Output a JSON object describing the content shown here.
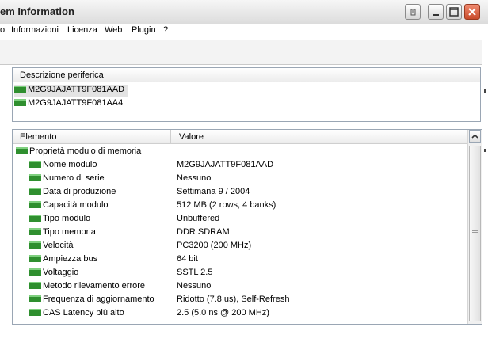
{
  "window": {
    "title": "em Information"
  },
  "menu": {
    "items": [
      {
        "label": "o"
      },
      {
        "label": "Informazioni"
      },
      {
        "label": "Licenza"
      },
      {
        "label": "Web"
      },
      {
        "label": "Plugin"
      },
      {
        "label": "?"
      }
    ]
  },
  "devices": {
    "header": "Descrizione periferica",
    "items": [
      {
        "label": "M2G9JAJATT9F081AAD",
        "selected": true,
        "icon": "memory-module-icon"
      },
      {
        "label": "M2G9JAJATT9F081AA4",
        "selected": false,
        "icon": "memory-module-icon"
      }
    ]
  },
  "properties": {
    "headers": {
      "element": "Elemento",
      "value": "Valore"
    },
    "group": {
      "label": "Proprietà modulo di memoria",
      "icon": "memory-module-icon"
    },
    "rows": [
      {
        "name": "Nome modulo",
        "value": "M2G9JAJATT9F081AAD"
      },
      {
        "name": "Numero di serie",
        "value": "Nessuno"
      },
      {
        "name": "Data di produzione",
        "value": "Settimana 9 / 2004"
      },
      {
        "name": "Capacità modulo",
        "value": "512 MB (2 rows, 4 banks)"
      },
      {
        "name": "Tipo modulo",
        "value": "Unbuffered"
      },
      {
        "name": "Tipo memoria",
        "value": "DDR SDRAM"
      },
      {
        "name": "Velocità",
        "value": "PC3200 (200 MHz)"
      },
      {
        "name": "Ampiezza bus",
        "value": "64 bit"
      },
      {
        "name": "Voltaggio",
        "value": "SSTL 2.5"
      },
      {
        "name": "Metodo rilevamento errore",
        "value": "Nessuno"
      },
      {
        "name": "Frequenza di aggiornamento",
        "value": "Ridotto (7.8 us), Self-Refresh"
      },
      {
        "name": "CAS Latency più alto",
        "value": "2.5 (5.0 ns @ 200 MHz)"
      }
    ]
  },
  "colors": {
    "chip": "#2f8f2f",
    "selection": "#e3e3e3",
    "close": "#c84a2a"
  }
}
